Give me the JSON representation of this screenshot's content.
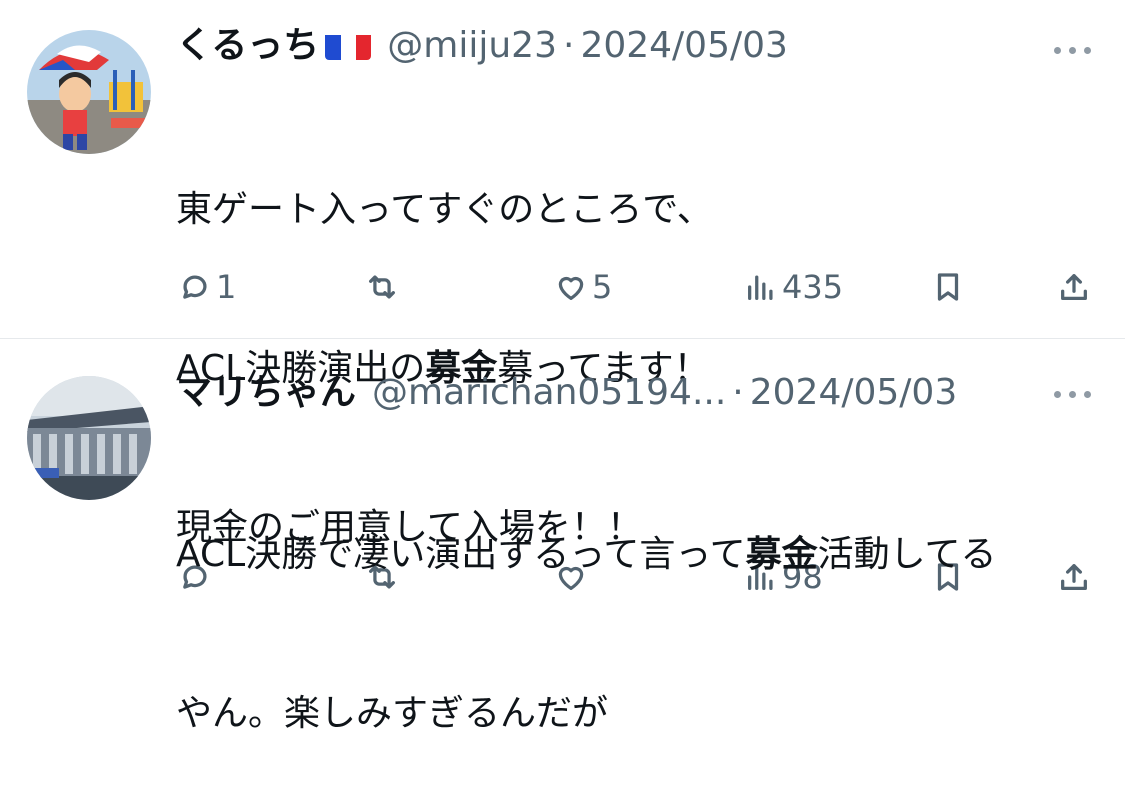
{
  "tweets": [
    {
      "display_name": "くるっち",
      "flag": "france-flag",
      "handle": "@miiju23",
      "separator": "·",
      "date": "2024/05/03",
      "text_lines": [
        [
          {
            "t": "東ゲート入ってすぐのところで、",
            "b": false
          }
        ],
        [
          {
            "t": "ACL決勝演出の",
            "b": false
          },
          {
            "t": "募金",
            "b": true
          },
          {
            "t": "募ってます！",
            "b": false
          }
        ],
        [
          {
            "t": "現金のご用意して入場を！！",
            "b": false
          }
        ]
      ],
      "replies": "1",
      "retweets": "",
      "likes": "5",
      "views": "435"
    },
    {
      "display_name": "マリちゃん",
      "handle": "@marichan05194...",
      "separator": "·",
      "date": "2024/05/03",
      "text_lines": [
        [
          {
            "t": "ACL決勝で凄い演出するって言って",
            "b": false
          },
          {
            "t": "募金",
            "b": true
          },
          {
            "t": "活動してる",
            "b": false
          }
        ],
        [
          {
            "t": "やん。楽しみすぎるんだが",
            "b": false
          }
        ]
      ],
      "replies": "",
      "retweets": "",
      "likes": "",
      "views": "98"
    }
  ],
  "colors": {
    "text": "#0f1419",
    "secondary": "#536471",
    "divider": "#e6e9ec",
    "flag_blue": "#1f4bd1",
    "flag_white": "#ffffff",
    "flag_red": "#e4262e"
  },
  "icons": [
    "more-icon",
    "reply-icon",
    "retweet-icon",
    "like-icon",
    "views-icon",
    "bookmark-icon",
    "share-icon"
  ]
}
